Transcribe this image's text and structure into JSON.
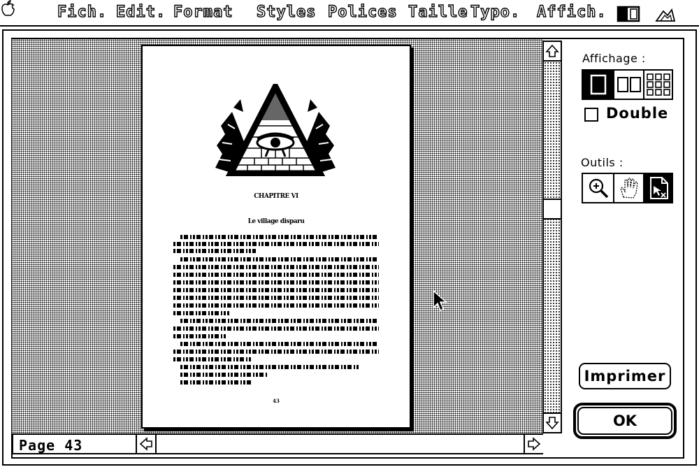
{
  "menubar": {
    "apple_icon": "apple-icon",
    "items": [
      "Fich.",
      "Edit.",
      "Format",
      "Styles",
      "Polices",
      "Taille",
      "Typo.",
      "Affich."
    ],
    "right_icons": [
      "split-view-icon",
      "drawing-tool-icon"
    ]
  },
  "page": {
    "chapter_heading": "CHAPITRE VI",
    "chapter_title": "Le village disparu",
    "page_number": "43",
    "illustration": "pyramid-eye-illustration"
  },
  "status": {
    "page_label": "Page 43"
  },
  "panel": {
    "display_label": "Affichage :",
    "display_modes": [
      "single-page-icon",
      "two-page-icon",
      "thumbnails-icon"
    ],
    "double_label": "Double",
    "double_checked": false,
    "tools_label": "Outils :",
    "tools": [
      "zoom-icon",
      "hand-icon",
      "page-select-icon"
    ],
    "print_label": "Imprimer",
    "ok_label": "OK"
  }
}
